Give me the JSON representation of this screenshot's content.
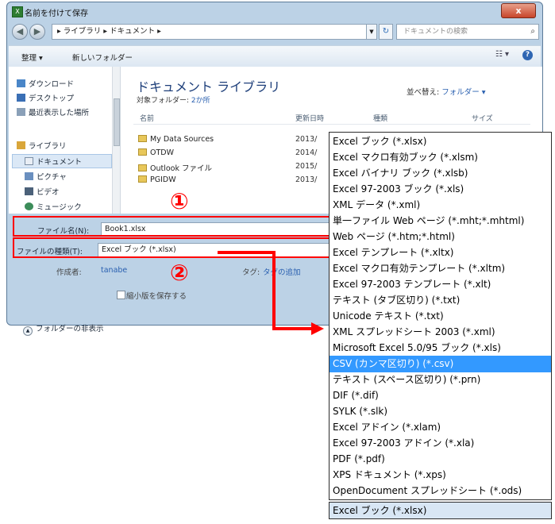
{
  "window": {
    "title": "名前を付けて保存",
    "close_label": "x"
  },
  "address": {
    "path": "▸ ライブラリ ▸ ドキュメント ▸",
    "search_placeholder": "ドキュメントの検索"
  },
  "toolbar": {
    "organize": "整理 ▾",
    "new_folder": "新しいフォルダー"
  },
  "sidebar": {
    "items": [
      {
        "label": "ダウンロード",
        "icon": "download-icon"
      },
      {
        "label": "デスクトップ",
        "icon": "desktop-icon"
      },
      {
        "label": "最近表示した場所",
        "icon": "recent-icon"
      },
      {
        "label": "ライブラリ",
        "icon": "library-icon"
      },
      {
        "label": "ドキュメント",
        "icon": "documents-icon"
      },
      {
        "label": "ピクチャ",
        "icon": "pictures-icon"
      },
      {
        "label": "ビデオ",
        "icon": "video-icon"
      },
      {
        "label": "ミュージック",
        "icon": "music-icon"
      }
    ]
  },
  "library": {
    "title": "ドキュメント ライブラリ",
    "subtitle_prefix": "対象フォルダー:",
    "subtitle_link": "2か所",
    "sort_prefix": "並べ替え:",
    "sort_value": "フォルダー ▾"
  },
  "columns": {
    "name": "名前",
    "date": "更新日時",
    "type": "種類",
    "size": "サイズ"
  },
  "files": [
    {
      "name": "My Data Sources",
      "date": "2013/"
    },
    {
      "name": "OTDW",
      "date": "2014/"
    },
    {
      "name": "Outlook ファイル",
      "date": "2015/"
    },
    {
      "name": "PGIDW",
      "date": "2013/"
    }
  ],
  "form": {
    "filename_label": "ファイル名(N):",
    "filename_value": "Book1.xlsx",
    "filetype_label": "ファイルの種類(T):",
    "filetype_value": "Excel ブック (*.xlsx)",
    "author_label": "作成者:",
    "author_value": "tanabe",
    "tags_label": "タグ:",
    "tags_value": "タグの追加",
    "thumbnail_label": "縮小版を保存する",
    "hide_folders": "フォルダーの非表示"
  },
  "markers": {
    "one": "①",
    "two": "②"
  },
  "filetypes": [
    "Excel ブック (*.xlsx)",
    "Excel マクロ有効ブック (*.xlsm)",
    "Excel バイナリ ブック (*.xlsb)",
    "Excel 97-2003 ブック (*.xls)",
    "XML データ (*.xml)",
    "単一ファイル Web ページ (*.mht;*.mhtml)",
    "Web ページ (*.htm;*.html)",
    "Excel テンプレート (*.xltx)",
    "Excel マクロ有効テンプレート (*.xltm)",
    "Excel 97-2003 テンプレート (*.xlt)",
    "テキスト (タブ区切り) (*.txt)",
    "Unicode テキスト (*.txt)",
    "XML スプレッドシート 2003 (*.xml)",
    "Microsoft Excel 5.0/95 ブック (*.xls)",
    "CSV (カンマ区切り) (*.csv)",
    "テキスト (スペース区切り) (*.prn)",
    "DIF (*.dif)",
    "SYLK (*.slk)",
    "Excel アドイン (*.xlam)",
    "Excel 97-2003 アドイン (*.xla)",
    "PDF (*.pdf)",
    "XPS ドキュメント (*.xps)",
    "OpenDocument スプレッドシート (*.ods)"
  ],
  "selected_filetype": "Excel ブック (*.xlsx)",
  "highlighted_filetype_index": 14,
  "colors": {
    "highlight": "#ff0000",
    "selection": "#3399ff"
  }
}
